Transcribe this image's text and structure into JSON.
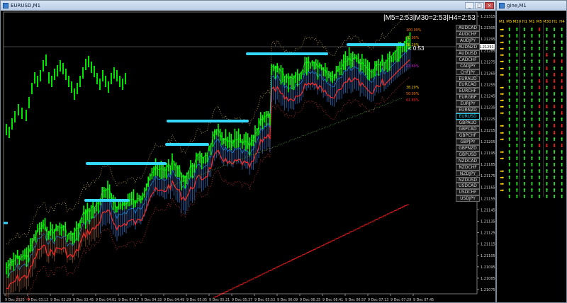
{
  "chart_window": {
    "title": "EURUSD,M1",
    "timer_text": "|M5=2:53|M30=2:53|H4=2:53",
    "countdown_text": "< 0:53",
    "fib_labels": [
      {
        "label": "100.00%",
        "color": "#ff7a00"
      },
      {
        "label": "50.00%",
        "color": "#ff7a00"
      },
      {
        "label": "38.20%",
        "color": "#ffd400"
      },
      {
        "label": "23.60%",
        "color": "#d020d0"
      },
      {
        "label": "38.20%",
        "color": "#ffd400"
      },
      {
        "label": "50.00%",
        "color": "#ff7a00"
      },
      {
        "label": "61.80%",
        "color": "#ff2020"
      }
    ],
    "symbols": [
      "AUDCAD",
      "AUDCHF",
      "AUDJPY",
      "AUDNZD",
      "AUDUSD",
      "CADCHF",
      "CADJPY",
      "CHFJPY",
      "EURAUD",
      "EURCAD",
      "EURCHF",
      "EURGBP",
      "EURJPY",
      "EURNZD",
      "EURUSD",
      "GBPAUD",
      "GBPCAD",
      "GBPCHF",
      "GBPJPY",
      "GBPNZD",
      "GBPUSD",
      "NZDCAD",
      "NZDCHF",
      "NZDJPY",
      "NZDUSD",
      "USDCAD",
      "USDCHF",
      "USDJPY"
    ],
    "active_symbol": "EURUSD",
    "price_axis": [
      "1.21315",
      "1.21305",
      "1.21295",
      "1.21285",
      "1.21275",
      "1.21265",
      "1.21255",
      "1.21245",
      "1.21235",
      "1.21225",
      "1.21215",
      "1.21205",
      "1.21195",
      "1.21185",
      "1.21175",
      "1.21165",
      "1.21155",
      "1.21145",
      "1.21135",
      "1.21125",
      "1.21115",
      "1.21105",
      "1.21095",
      "1.21085",
      "1.21075"
    ],
    "current_price": "1.21291",
    "time_axis": [
      "9 Dec 2020",
      "9 Dec 03:13",
      "9 Dec 03:29",
      "9 Dec 03:45",
      "9 Dec 04:01",
      "9 Dec 04:17",
      "9 Dec 04:33",
      "9 Dec 04:49",
      "9 Dec 05:05",
      "9 Dec 05:21",
      "9 Dec 05:37",
      "9 Dec 05:53",
      "9 Dec 06:09",
      "9 Dec 06:25",
      "9 Dec 06:41",
      "9 Dec 06:57",
      "9 Dec 07:13",
      "9 Dec 07:29",
      "9 Dec 07:45"
    ]
  },
  "dashboard_window": {
    "title": "gine,M1",
    "headers": [
      "M1",
      "M5",
      "M30",
      "H1",
      "M1",
      "M5",
      "M30",
      "H1",
      "H4"
    ],
    "rows": [
      [
        "y",
        "up",
        "up",
        "up",
        "up",
        "dn",
        "up",
        "up",
        "up"
      ],
      [
        "y",
        "up",
        "up",
        "up",
        "up",
        "up",
        "up",
        "up",
        "up"
      ],
      [
        "y",
        "up",
        "up",
        "up",
        "up",
        "up",
        "up",
        "up",
        "up"
      ],
      [
        "y",
        "up",
        "up",
        "up",
        "up",
        "up",
        "up",
        "up",
        "up"
      ],
      [
        "y",
        "up",
        "up",
        "up",
        "up",
        "up",
        "dn",
        "up",
        "up"
      ],
      [
        "y",
        "up",
        "up",
        "up",
        "up",
        "up",
        "up",
        "dn",
        "dn"
      ],
      [
        "y",
        "up",
        "up",
        "up",
        "up",
        "up",
        "dn",
        "up",
        "up"
      ],
      [
        "y",
        "up",
        "up",
        "up",
        "up",
        "up",
        "up",
        "dn",
        "dn"
      ],
      [
        "e",
        "up",
        "up",
        "up",
        "up",
        "dn",
        "dn",
        "dn",
        "dn"
      ],
      [
        "y",
        "up",
        "up",
        "up",
        "up",
        "dn",
        "up",
        "dn",
        "dn"
      ],
      [
        "y",
        "up",
        "up",
        "up",
        "up",
        "up",
        "up",
        "up",
        "up"
      ],
      [
        "y",
        "up",
        "up",
        "up",
        "up",
        "up",
        "up",
        "up",
        "up"
      ],
      [
        "y",
        "up",
        "up",
        "up",
        "up",
        "dn",
        "dn",
        "dn",
        "dn"
      ],
      [
        "y",
        "up",
        "up",
        "up",
        "up",
        "up",
        "up",
        "up",
        "dn"
      ],
      [
        "e",
        "up",
        "up",
        "up",
        "up",
        "up",
        "up",
        "up",
        "up"
      ],
      [
        "y",
        "up",
        "up",
        "up",
        "up",
        "dn",
        "up",
        "dn",
        "dn"
      ],
      [
        "y",
        "up",
        "up",
        "up",
        "up",
        "dn",
        "up",
        "dn",
        "dn"
      ],
      [
        "y",
        "up",
        "up",
        "up",
        "up",
        "up",
        "up",
        "up",
        "up"
      ],
      [
        "e",
        "up",
        "up",
        "up",
        "up",
        "dn",
        "dn",
        "dn",
        "dn"
      ],
      [
        "y",
        "up",
        "up",
        "up",
        "up",
        "up",
        "up",
        "up",
        "up"
      ],
      [
        "y",
        "up",
        "up",
        "up",
        "up",
        "up",
        "up",
        "up",
        "up"
      ],
      [
        "e",
        "up",
        "up",
        "up",
        "up",
        "up",
        "up",
        "up",
        "up"
      ],
      [
        "y",
        "up",
        "up",
        "up",
        "up",
        "up",
        "up",
        "up",
        "up"
      ],
      [
        "y",
        "up",
        "up",
        "up",
        "up",
        "up",
        "up",
        "up",
        "up"
      ],
      [
        "y",
        "up",
        "up",
        "up",
        "up",
        "up",
        "up",
        "up",
        "up"
      ],
      [
        "y",
        "up",
        "up",
        "up",
        "up",
        "up",
        "up",
        "up",
        "up"
      ],
      [
        "e",
        "up",
        "up",
        "up",
        "up",
        "up",
        "up",
        "up",
        "up"
      ]
    ]
  }
}
